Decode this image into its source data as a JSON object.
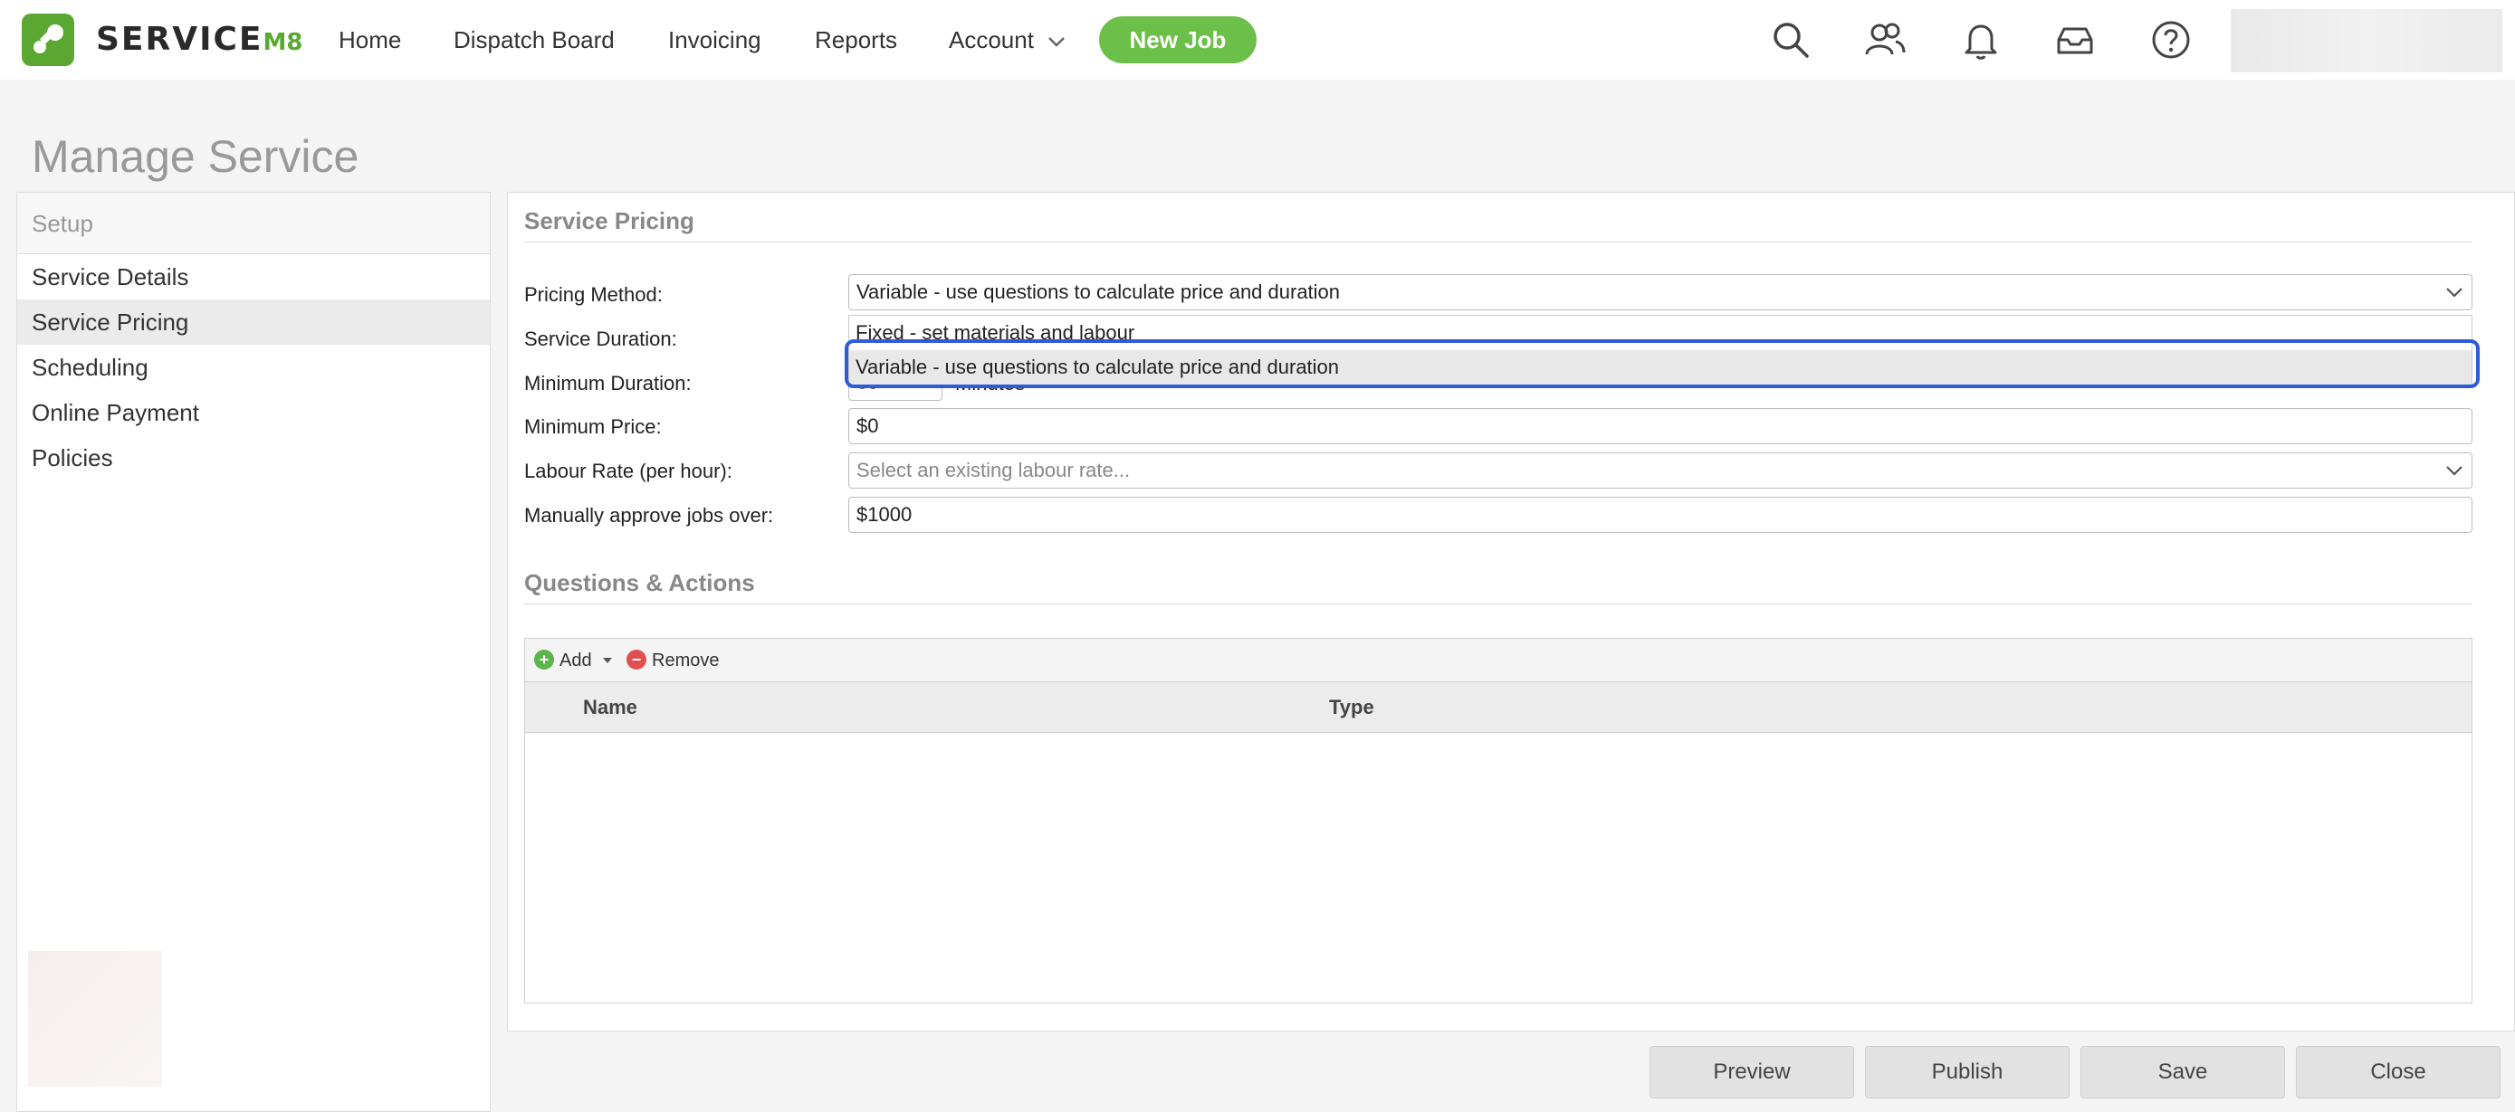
{
  "header": {
    "brand": "SERVICE",
    "brand_suffix": "M8",
    "nav": [
      "Home",
      "Dispatch Board",
      "Invoicing",
      "Reports",
      "Account"
    ],
    "new_job_label": "New Job",
    "icons": [
      "search-icon",
      "people-icon",
      "bell-icon",
      "inbox-icon",
      "help-icon"
    ],
    "accent_color": "#6cc04a"
  },
  "page": {
    "title": "Manage Service"
  },
  "sidebar": {
    "heading": "Setup",
    "items": [
      {
        "label": "Service Details",
        "active": false
      },
      {
        "label": "Service Pricing",
        "active": true
      },
      {
        "label": "Scheduling",
        "active": false
      },
      {
        "label": "Online Payment",
        "active": false
      },
      {
        "label": "Policies",
        "active": false
      }
    ]
  },
  "pricing": {
    "section_title": "Service Pricing",
    "pricing_method_label": "Pricing Method:",
    "pricing_method_value": "Variable - use questions to calculate price and duration",
    "options": [
      "Fixed - set materials and labour",
      "Variable - use questions to calculate price and duration"
    ],
    "service_duration_label": "Service Duration:",
    "minimum_duration_label": "Minimum Duration:",
    "minimum_duration_value": "60",
    "minimum_duration_unit": "Minutes",
    "minimum_price_label": "Minimum Price:",
    "minimum_price_value": "$0",
    "labour_rate_label": "Labour Rate (per hour):",
    "labour_rate_placeholder": "Select an existing labour rate...",
    "approve_label": "Manually approve jobs over:",
    "approve_value": "$1000"
  },
  "questions": {
    "section_title": "Questions & Actions",
    "add_label": "Add",
    "remove_label": "Remove",
    "columns": [
      "Name",
      "Type"
    ]
  },
  "footer": {
    "buttons": [
      "Preview",
      "Publish",
      "Save",
      "Close"
    ]
  }
}
